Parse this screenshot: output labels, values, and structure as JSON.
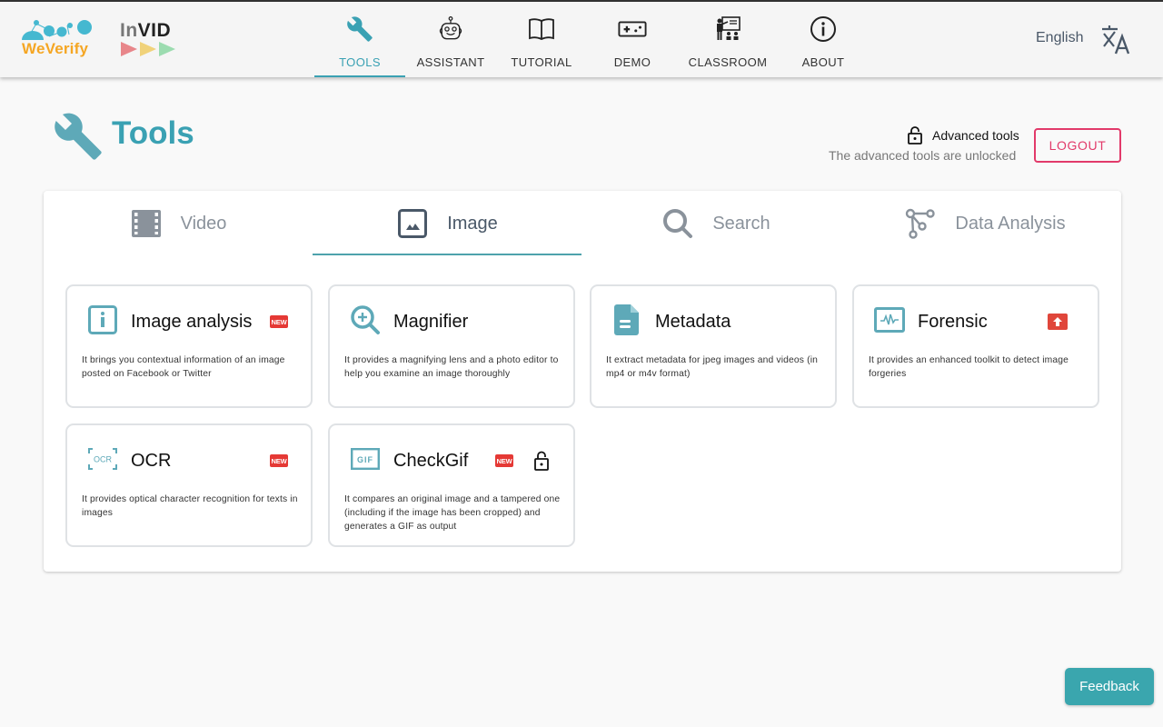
{
  "header": {
    "logos": {
      "weverify": "WeVerify",
      "invid_prefix": "In",
      "invid_suffix": "VID"
    },
    "nav": [
      {
        "label": "TOOLS",
        "icon": "wrench-icon",
        "active": true
      },
      {
        "label": "ASSISTANT",
        "icon": "robot-icon",
        "active": false
      },
      {
        "label": "TUTORIAL",
        "icon": "book-icon",
        "active": false
      },
      {
        "label": "DEMO",
        "icon": "gamepad-icon",
        "active": false
      },
      {
        "label": "CLASSROOM",
        "icon": "classroom-icon",
        "active": false
      },
      {
        "label": "ABOUT",
        "icon": "info-icon",
        "active": false
      }
    ],
    "language": "English",
    "language_icon": "translate-icon"
  },
  "page": {
    "title": "Tools",
    "title_icon": "wrench-icon",
    "advanced": {
      "label": "Advanced tools",
      "status": "The advanced tools are unlocked",
      "icon": "lock-open-icon"
    },
    "logout_label": "LOGOUT"
  },
  "tabs": [
    {
      "label": "Video",
      "icon": "film-icon",
      "active": false
    },
    {
      "label": "Image",
      "icon": "image-icon",
      "active": true
    },
    {
      "label": "Search",
      "icon": "search-icon",
      "active": false
    },
    {
      "label": "Data Analysis",
      "icon": "graph-nodes-icon",
      "active": false
    }
  ],
  "cards": [
    {
      "title": "Image analysis",
      "icon": "info-square-icon",
      "badge": "NEW",
      "description": "It brings you contextual information of an image posted on Facebook or Twitter"
    },
    {
      "title": "Magnifier",
      "icon": "zoom-in-icon",
      "description": "It provides a magnifying lens and a photo editor to help you examine an image thoroughly"
    },
    {
      "title": "Metadata",
      "icon": "document-icon",
      "description": "It extract metadata for jpeg images and videos (in mp4 or m4v format)"
    },
    {
      "title": "Forensic",
      "icon": "monitor-pulse-icon",
      "badge_icon": "upgrade-icon",
      "description": "It provides an enhanced toolkit to detect image forgeries"
    },
    {
      "title": "OCR",
      "icon": "ocr-icon",
      "icon_text": "OCR",
      "badge": "NEW",
      "description": "It provides optical character recognition for texts in images"
    },
    {
      "title": "CheckGif",
      "icon": "gif-icon",
      "icon_text": "GIF",
      "badge": "NEW",
      "lock_icon": "lock-open-icon",
      "description": "It compares an original image and a tampered one (including if the image has been cropped) and generates a GIF as output"
    }
  ],
  "feedback_label": "Feedback",
  "colors": {
    "accent": "#3aa1b3",
    "logout": "#e23a6a",
    "badge": "#e53935",
    "feedback": "#3aa6ae"
  }
}
